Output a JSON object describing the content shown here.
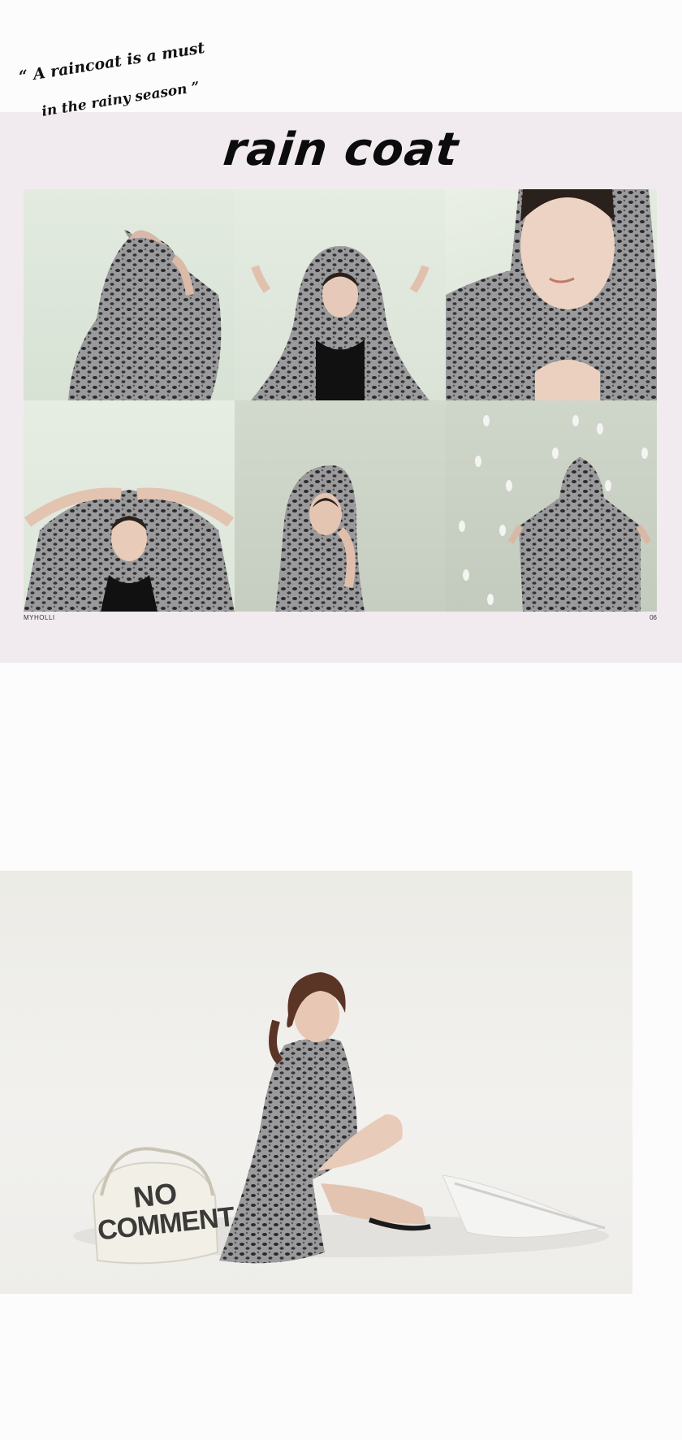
{
  "quote": {
    "line1": "“ A raincoat is a must",
    "line2": "in the rainy season ”"
  },
  "title": "rain coat",
  "grid_photos": [
    {
      "subject": "model-arms-raised-hood"
    },
    {
      "subject": "model-hood-front"
    },
    {
      "subject": "model-closeup-smile"
    },
    {
      "subject": "model-hands-on-head"
    },
    {
      "subject": "model-hood-side"
    },
    {
      "subject": "model-back-raindrops"
    }
  ],
  "footer": {
    "brand": "MYHOLLI",
    "page": "06"
  },
  "big_photo": {
    "bag_text_line1": "NO",
    "bag_text_line2": "COMMENT"
  },
  "colors": {
    "panel": "#f1ebef",
    "leopard": "#8a8a8a"
  }
}
